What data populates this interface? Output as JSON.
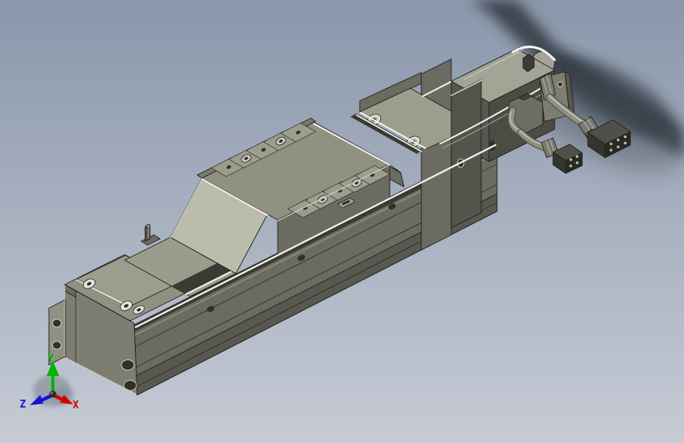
{
  "viewport": {
    "kind": "3d-cad-viewport",
    "content": "isometric shaded view of a belt-driven linear actuator slide unit with stepper motor and two motor cables"
  },
  "axis_triad": {
    "x_label": "X",
    "y_label": "Y",
    "z_label": "Z"
  },
  "scene": {
    "components": [
      "base-rail-extrusion",
      "left-end-block-with-mounting-flange",
      "slider-carriage-with-tapped-holes",
      "sensor-bracket",
      "pulley-end-block",
      "motor-mount-housing",
      "stepper-motor-with-rounded-cap",
      "connector-housing-block",
      "upper-motor-cable-with-6pin-connector",
      "lower-motor-cable-with-4pin-connector",
      "cast-shadow-on-background"
    ],
    "upper_connector_pins": 6,
    "lower_connector_pins": 4
  },
  "palette": {
    "bg_top": "#8a97ab",
    "bg_bottom": "#c6cbd5",
    "edge": "#20201c",
    "face_top": "#919183",
    "face_top_light": "#9c9c8e",
    "face_bright": "#bcbcad",
    "face_side": "#7d7d72",
    "face_front": "#6b6b60",
    "face_front_dark": "#585850",
    "ledge": "#7a7a6c",
    "groove": "#3a3a33",
    "plate": "#9d9d8e",
    "hole_dark": "#30302a",
    "hole_silver": "#e3e3da",
    "ring_light": "#c9c9bd",
    "motor_top": "#a3a396",
    "motor_side": "#575750",
    "motor_face": "#4c4c45",
    "mount_dark": "#54544d",
    "cap_bright": "#d8d8cc",
    "cable": "#8f8f82",
    "cable_dark": "#55554e",
    "boot": "#7a7a70",
    "connector": "#50504a",
    "connector_dark": "#2a2a25",
    "pin_light": "#c0c0b2",
    "highlight": "#f3f3ed",
    "highlight_soft": "#c9c9c0",
    "shadow_dark": "#2c333b",
    "shadow_soft": "#4a525c",
    "triad_shadow": "#7e8894",
    "axis_x": "#d40000",
    "axis_y": "#00b400",
    "axis_z": "#1414d4"
  }
}
